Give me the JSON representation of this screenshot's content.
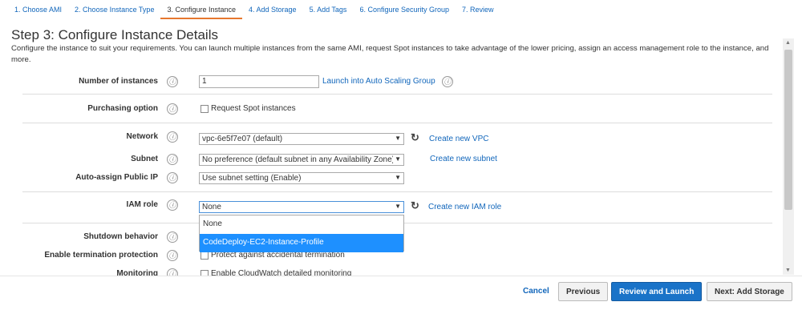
{
  "tabs": [
    {
      "label": "1. Choose AMI"
    },
    {
      "label": "2. Choose Instance Type"
    },
    {
      "label": "3. Configure Instance"
    },
    {
      "label": "4. Add Storage"
    },
    {
      "label": "5. Add Tags"
    },
    {
      "label": "6. Configure Security Group"
    },
    {
      "label": "7. Review"
    }
  ],
  "page": {
    "title": "Step 3: Configure Instance Details",
    "description": "Configure the instance to suit your requirements. You can launch multiple instances from the same AMI, request Spot instances to take advantage of the lower pricing, assign an access management role to the instance, and more."
  },
  "form": {
    "num_instances": {
      "label": "Number of instances",
      "value": "1",
      "link": "Launch into Auto Scaling Group"
    },
    "purchasing": {
      "label": "Purchasing option",
      "checkbox_label": "Request Spot instances"
    },
    "network": {
      "label": "Network",
      "value": "vpc-6e5f7e07 (default)",
      "link": "Create new VPC"
    },
    "subnet": {
      "label": "Subnet",
      "value": "No preference (default subnet in any Availability Zone)",
      "link": "Create new subnet"
    },
    "public_ip": {
      "label": "Auto-assign Public IP",
      "value": "Use subnet setting (Enable)"
    },
    "iam_role": {
      "label": "IAM role",
      "value": "None",
      "link": "Create new IAM role",
      "options": [
        "None",
        "CodeDeploy-EC2-Instance-Profile"
      ]
    },
    "shutdown": {
      "label": "Shutdown behavior"
    },
    "termination": {
      "label": "Enable termination protection",
      "checkbox_label": "Protect against accidental termination"
    },
    "monitoring": {
      "label": "Monitoring",
      "checkbox_label": "Enable CloudWatch detailed monitoring"
    }
  },
  "icons": {
    "info": "ⓘ",
    "refresh": "↻",
    "dropdown": "▼"
  },
  "footer": {
    "cancel": "Cancel",
    "previous": "Previous",
    "review": "Review and Launch",
    "next": "Next: Add Storage"
  },
  "colors": {
    "link": "#1166bb",
    "primary_button": "#1a73c8",
    "active_tab_underline": "#e6772e",
    "selected_option": "#1e90ff"
  }
}
